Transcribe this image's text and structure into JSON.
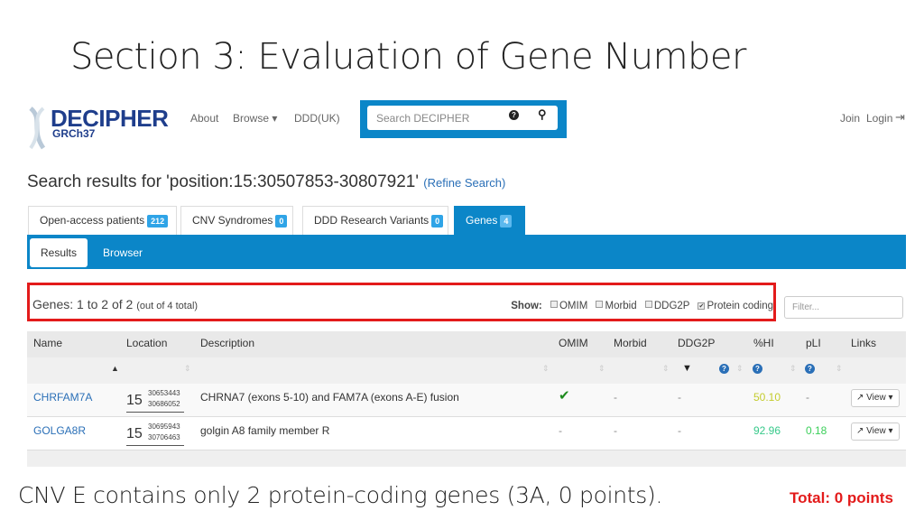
{
  "slide": {
    "title": "Section 3: Evaluation of Gene Number",
    "caption": "CNV E contains only 2 protein-coding genes (3A, 0 points).",
    "total": "Total: 0 points"
  },
  "header": {
    "logo": "DECIPHER",
    "build": "GRCh37",
    "nav": [
      "About",
      "Browse ▾",
      "DDD(UK)"
    ],
    "search_placeholder": "Search DECIPHER",
    "join": "Join",
    "login": "Login"
  },
  "search": {
    "heading": "Search results for 'position:15:30507853-30807921'",
    "refine": "(Refine Search)"
  },
  "tabs": [
    {
      "label": "Open-access patients",
      "count": "212"
    },
    {
      "label": "CNV Syndromes",
      "count": "0"
    },
    {
      "label": "DDD Research Variants",
      "count": "0"
    },
    {
      "label": "Genes",
      "count": "4",
      "active": true
    }
  ],
  "subtabs": {
    "results": "Results",
    "browser": "Browser"
  },
  "summary": {
    "count": "Genes: 1 to 2 of 2",
    "total": "(out of 4 total)",
    "show": "Show:",
    "filters": [
      {
        "label": "OMIM",
        "checked": false
      },
      {
        "label": "Morbid",
        "checked": false
      },
      {
        "label": "DDG2P",
        "checked": false
      },
      {
        "label": "Protein coding",
        "checked": true
      }
    ],
    "filter_placeholder": "Filter..."
  },
  "table": {
    "headers": [
      "Name",
      "Location",
      "Description",
      "OMIM",
      "Morbid",
      "DDG2P",
      "%HI",
      "pLI",
      "Links"
    ],
    "rows": [
      {
        "name": "CHRFAM7A",
        "chr": "15",
        "start": "30653443",
        "end": "30686052",
        "description": "CHRNA7 (exons 5-10) and FAM7A (exons A-E) fusion",
        "omim": "✔",
        "morbid": "-",
        "ddg2p": "-",
        "hi": "50.10",
        "pli": "-",
        "link": "View ▾",
        "hi_color": "#c4cc2e",
        "pli_color": "#888"
      },
      {
        "name": "GOLGA8R",
        "chr": "15",
        "start": "30695943",
        "end": "30706463",
        "description": "golgin A8 family member R",
        "omim": "-",
        "morbid": "-",
        "ddg2p": "-",
        "hi": "92.96",
        "pli": "0.18",
        "link": "View ▾",
        "hi_color": "#36c98a",
        "pli_color": "#3ccf5a"
      }
    ]
  },
  "colors": {
    "brand": "#0b86c8",
    "highlight": "#e31b1b",
    "link": "#2a6fb7"
  }
}
